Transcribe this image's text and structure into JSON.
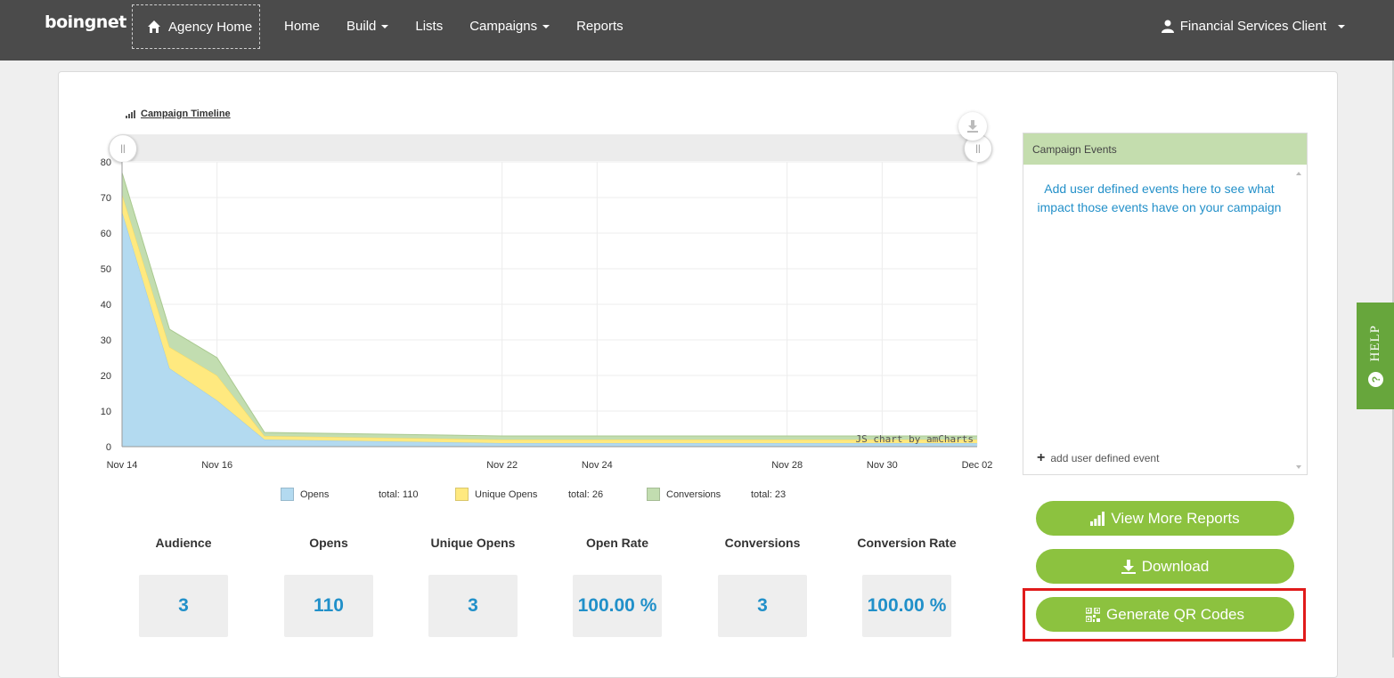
{
  "nav": {
    "logo": "boingnet",
    "agency_home": "Agency Home",
    "links": [
      {
        "label": "Home",
        "dropdown": false
      },
      {
        "label": "Build",
        "dropdown": true
      },
      {
        "label": "Lists",
        "dropdown": false
      },
      {
        "label": "Campaigns",
        "dropdown": true
      },
      {
        "label": "Reports",
        "dropdown": false
      }
    ],
    "user": "Financial Services Client"
  },
  "chart_header": {
    "title": "Campaign Timeline",
    "credit": "JS chart by amCharts"
  },
  "chart_data": {
    "type": "area",
    "stacked": true,
    "x_labels": [
      "Nov 14",
      "Nov 16",
      "Nov 22",
      "Nov 24",
      "Nov 28",
      "Nov 30",
      "Dec 02"
    ],
    "x": [
      "Nov 14",
      "Nov 15",
      "Nov 16",
      "Nov 17",
      "Nov 22",
      "Nov 24",
      "Nov 28",
      "Nov 30",
      "Dec 02"
    ],
    "series": [
      {
        "name": "Opens",
        "color": "#b3daf0",
        "stroke": "#9ccbe3",
        "values": [
          66,
          22,
          13,
          2,
          1,
          1,
          1,
          1,
          1
        ]
      },
      {
        "name": "Unique Opens",
        "color": "#ffe97f",
        "stroke": "#f0d966",
        "values": [
          5,
          6,
          7,
          1,
          1,
          1,
          1,
          1,
          1
        ]
      },
      {
        "name": "Conversions",
        "color": "#c2ddb0",
        "stroke": "#a9c98f",
        "values": [
          6,
          5,
          5,
          1,
          1,
          1,
          1,
          1,
          1
        ]
      }
    ],
    "ylim": [
      0,
      80
    ],
    "yticks": [
      0,
      10,
      20,
      30,
      40,
      50,
      60,
      70,
      80
    ],
    "grid": true,
    "legend": [
      {
        "name": "Opens",
        "total": "total: 110",
        "color": "#b3daf0"
      },
      {
        "name": "Unique Opens",
        "total": "total: 26",
        "color": "#ffe97f"
      },
      {
        "name": "Conversions",
        "total": "total: 23",
        "color": "#c2ddb0"
      }
    ],
    "legend_position": "bottom"
  },
  "stats": [
    {
      "label": "Audience",
      "value": "3"
    },
    {
      "label": "Opens",
      "value": "110"
    },
    {
      "label": "Unique Opens",
      "value": "3"
    },
    {
      "label": "Open Rate",
      "value": "100.00 %"
    },
    {
      "label": "Conversions",
      "value": "3"
    },
    {
      "label": "Conversion Rate",
      "value": "100.00 %"
    }
  ],
  "events": {
    "header": "Campaign Events",
    "message": "Add user defined events here to see what impact those events have on your campaign",
    "add_label": "add user defined event"
  },
  "actions": {
    "view_reports": "View More Reports",
    "download": "Download",
    "qr": "Generate QR Codes"
  },
  "help": "HELP",
  "colors": {
    "nav_bg": "#4b4b4b",
    "accent_green": "#8cc23f",
    "link_blue": "#2390c9",
    "highlight_red": "#e01b1b"
  }
}
